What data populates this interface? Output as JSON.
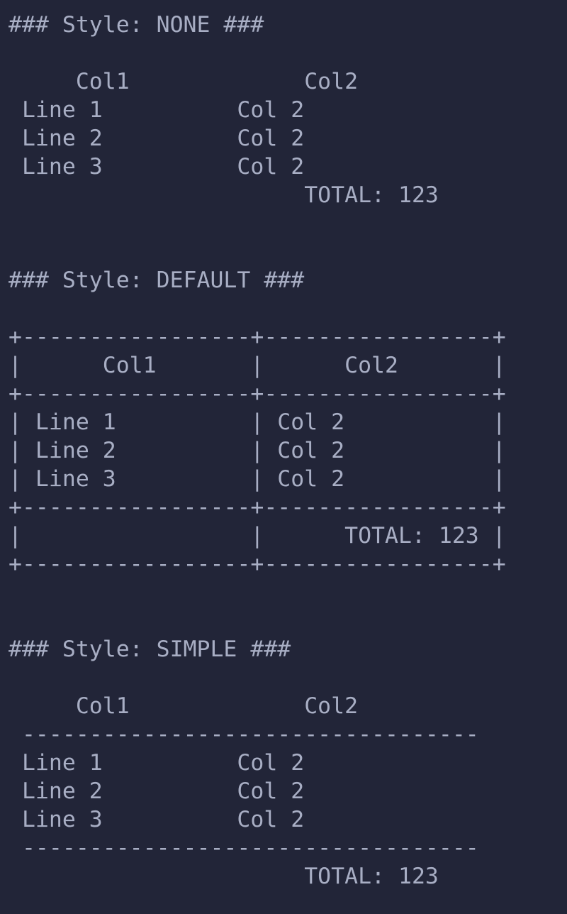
{
  "terminal": {
    "lines": [
      "### Style: NONE ###",
      "",
      "     Col1             Col2",
      " Line 1          Col 2",
      " Line 2          Col 2",
      " Line 3          Col 2",
      "                      TOTAL: 123",
      "",
      "",
      "### Style: DEFAULT ###",
      "",
      "+-----------------+-----------------+",
      "|      Col1       |      Col2       |",
      "+-----------------+-----------------+",
      "| Line 1          | Col 2           |",
      "| Line 2          | Col 2           |",
      "| Line 3          | Col 2           |",
      "+-----------------+-----------------+",
      "|                 |      TOTAL: 123 |",
      "+-----------------+-----------------+",
      "",
      "",
      "### Style: SIMPLE ###",
      "",
      "     Col1             Col2",
      " ----------------------------------",
      " Line 1          Col 2",
      " Line 2          Col 2",
      " Line 3          Col 2",
      " ----------------------------------",
      "                      TOTAL: 123"
    ]
  },
  "colors": {
    "background": "#222538",
    "text": "#a8aec4"
  }
}
